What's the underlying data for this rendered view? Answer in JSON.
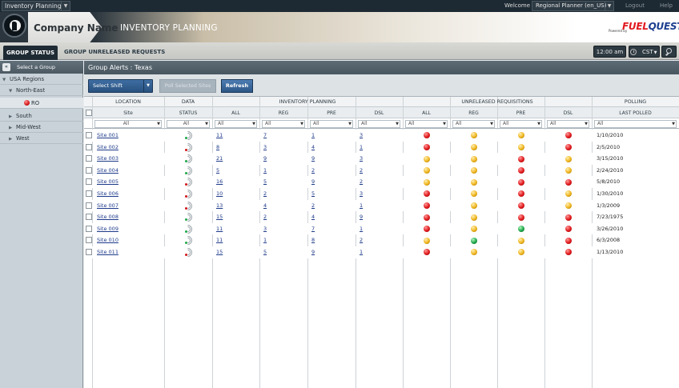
{
  "topbar": {
    "app_select": "Inventory Planning",
    "welcome": "Welcome",
    "user_select": "Regional Planner (en_US)",
    "logout": "Logout",
    "help": "Help"
  },
  "header": {
    "company_name": "Company Name",
    "page_title": "INVENTORY PLANNING",
    "powered_by": "Powered by",
    "brand_a": "FUEL",
    "brand_b": "QUEST"
  },
  "tabs": [
    {
      "label": "GROUP STATUS",
      "active": true
    },
    {
      "label": "GROUP UNRELEASED REQUESTS",
      "active": false
    }
  ],
  "clock": "12:00 am",
  "timezone": "CST",
  "sidebar": {
    "title": "Select a Group",
    "tree": [
      {
        "label": "USA Regions",
        "level": 0,
        "arrow": "▼"
      },
      {
        "label": "North-East",
        "level": 1,
        "arrow": "▼"
      },
      {
        "label": "RO",
        "level": 2,
        "arrow": ""
      },
      {
        "label": "South",
        "level": 1,
        "arrow": "▶"
      },
      {
        "label": "Mid-West",
        "level": 1,
        "arrow": "▶"
      },
      {
        "label": "West",
        "level": 1,
        "arrow": "▶"
      }
    ]
  },
  "main": {
    "group_title": "Group Alerts : Texas",
    "select_shift": "Select Shift",
    "poll_button": "Poll Selected Sites",
    "refresh_button": "Refresh"
  },
  "table": {
    "group_headers": [
      "LOCATION",
      "DATA",
      "INVENTORY PLANNING",
      "UNRELEASED REQUISITIONS",
      "POLLING"
    ],
    "sub_headers": [
      "Site",
      "STATUS",
      "ALL",
      "REG",
      "PRE",
      "DSL",
      "ALL",
      "REG",
      "PRE",
      "DSL",
      "LAST POLLED"
    ],
    "filter_value": "All",
    "rows": [
      {
        "site": "Site 001",
        "status": "green",
        "ip": [
          "11",
          "7",
          "1",
          "3"
        ],
        "ur": [
          "red",
          "yellow",
          "yellow",
          "red"
        ],
        "polled": "1/10/2010"
      },
      {
        "site": "Site 002",
        "status": "red",
        "ip": [
          "8",
          "3",
          "4",
          "1"
        ],
        "ur": [
          "red",
          "yellow",
          "yellow",
          "red"
        ],
        "polled": "2/5/2010"
      },
      {
        "site": "Site 003",
        "status": "green",
        "ip": [
          "21",
          "9",
          "9",
          "3"
        ],
        "ur": [
          "yellow",
          "yellow",
          "red",
          "yellow"
        ],
        "polled": "3/15/2010"
      },
      {
        "site": "Site 004",
        "status": "green",
        "ip": [
          "5",
          "1",
          "2",
          "2"
        ],
        "ur": [
          "yellow",
          "yellow",
          "red",
          "yellow"
        ],
        "polled": "2/24/2010"
      },
      {
        "site": "Site 005",
        "status": "red",
        "ip": [
          "16",
          "5",
          "9",
          "2"
        ],
        "ur": [
          "yellow",
          "yellow",
          "red",
          "red"
        ],
        "polled": "5/8/2010"
      },
      {
        "site": "Site 006",
        "status": "red",
        "ip": [
          "10",
          "2",
          "5",
          "3"
        ],
        "ur": [
          "red",
          "yellow",
          "red",
          "yellow"
        ],
        "polled": "1/30/2010"
      },
      {
        "site": "Site 007",
        "status": "red",
        "ip": [
          "13",
          "4",
          "2",
          "1"
        ],
        "ur": [
          "red",
          "yellow",
          "red",
          "yellow"
        ],
        "polled": "1/3/2009"
      },
      {
        "site": "Site 008",
        "status": "green",
        "ip": [
          "15",
          "2",
          "4",
          "9"
        ],
        "ur": [
          "red",
          "yellow",
          "red",
          "red"
        ],
        "polled": "7/23/1975"
      },
      {
        "site": "Site 009",
        "status": "green",
        "ip": [
          "11",
          "3",
          "7",
          "1"
        ],
        "ur": [
          "red",
          "yellow",
          "green",
          "red"
        ],
        "polled": "3/26/2010"
      },
      {
        "site": "Site 010",
        "status": "green",
        "ip": [
          "11",
          "1",
          "8",
          "2"
        ],
        "ur": [
          "yellow",
          "green",
          "yellow",
          "red"
        ],
        "polled": "6/3/2008"
      },
      {
        "site": "Site 011",
        "status": "red",
        "ip": [
          "15",
          "5",
          "9",
          "1"
        ],
        "ur": [
          "red",
          "yellow",
          "yellow",
          "red"
        ],
        "polled": "1/13/2010"
      }
    ]
  },
  "colors": {
    "accent": "#2c5686",
    "header_dark": "#1e2a33",
    "status_red": "#e0181b",
    "status_yellow": "#efb51e",
    "status_green": "#1fa84a"
  }
}
